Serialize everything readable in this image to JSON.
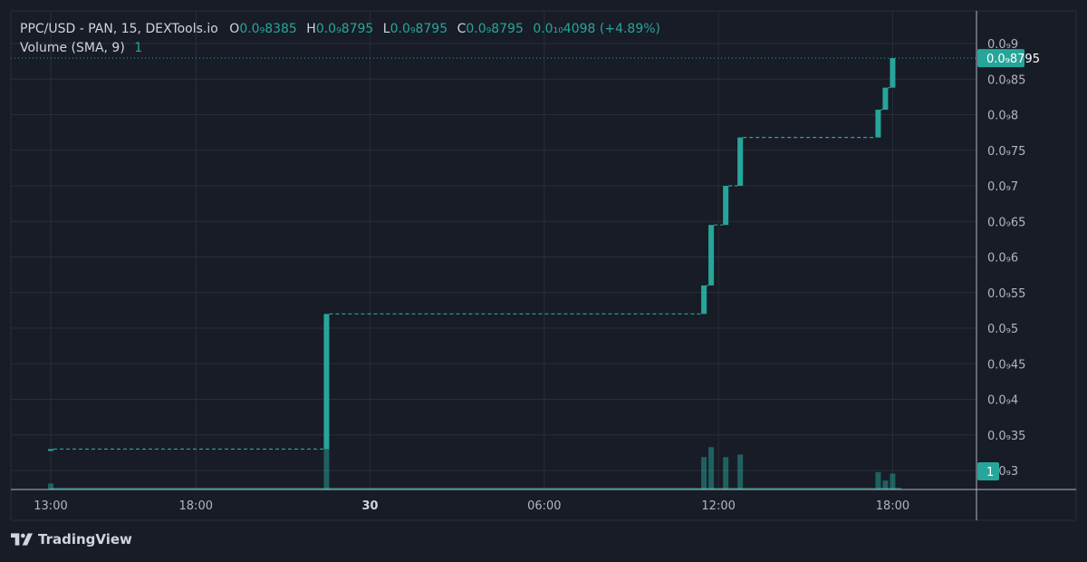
{
  "legend": {
    "symbol": "PPC/USD - PAN, 15, DEXTools.io",
    "open_key": "O",
    "open_val": "0.0₉8385",
    "high_key": "H",
    "high_val": "0.0₉8795",
    "low_key": "L",
    "low_val": "0.0₉8795",
    "close_key": "C",
    "close_val": "0.0₉8795",
    "change": "0.0₁₀4098 (+4.89%)",
    "volume_label": "Volume (SMA, 9)",
    "volume_value": "1"
  },
  "brand": {
    "name": "TradingView",
    "icon": "tradingview-logo-icon"
  },
  "colors": {
    "up": "#26a69a",
    "grid": "#2a2e39",
    "background": "#181c27",
    "volume": "#26a69a80"
  },
  "chart_data": {
    "type": "candlestick",
    "price_scale_labels": [
      "0.0₉9",
      "0.0₉85",
      "0.0₉8",
      "0.0₉75",
      "0.0₉7",
      "0.0₉65",
      "0.0₉6",
      "0.0₉55",
      "0.0₉5",
      "0.0₉45",
      "0.0₉4",
      "0.0₉35",
      "0.0₉3"
    ],
    "price_scale_values": [
      0.9,
      0.85,
      0.8,
      0.75,
      0.7,
      0.65,
      0.6,
      0.55,
      0.5,
      0.45,
      0.4,
      0.35,
      0.3
    ],
    "price_unit": "×1e-10",
    "ylim": [
      0.28,
      0.93
    ],
    "x_ticks": [
      {
        "label": "13:00",
        "hour": 0
      },
      {
        "label": "18:00",
        "hour": 5
      },
      {
        "label": "30",
        "hour": 11
      },
      {
        "label": "06:00",
        "hour": 17
      },
      {
        "label": "12:00",
        "hour": 23
      },
      {
        "label": "18:00",
        "hour": 29
      }
    ],
    "xlim_hours": [
      0,
      33.5
    ],
    "current_price_label": "0.0₉8795",
    "current_price_value": 0.8795,
    "volume_label": "1",
    "candles": [
      {
        "t": 0.0,
        "o": 0.33,
        "c": 0.33
      },
      {
        "t": 9.5,
        "o": 0.33,
        "c": 0.52
      },
      {
        "t": 22.5,
        "o": 0.52,
        "c": 0.56
      },
      {
        "t": 22.75,
        "o": 0.56,
        "c": 0.645
      },
      {
        "t": 23.25,
        "o": 0.645,
        "c": 0.7
      },
      {
        "t": 23.75,
        "o": 0.7,
        "c": 0.768
      },
      {
        "t": 28.5,
        "o": 0.768,
        "c": 0.807
      },
      {
        "t": 28.75,
        "o": 0.807,
        "c": 0.838
      },
      {
        "t": 29.0,
        "o": 0.838,
        "c": 0.8795
      }
    ],
    "volumes": [
      {
        "t": 0.0,
        "v": 0.12
      },
      {
        "t": 9.5,
        "v": 1.0
      },
      {
        "t": 22.5,
        "v": 0.65
      },
      {
        "t": 22.75,
        "v": 0.85
      },
      {
        "t": 23.25,
        "v": 0.65
      },
      {
        "t": 23.75,
        "v": 0.7
      },
      {
        "t": 28.5,
        "v": 0.35
      },
      {
        "t": 28.75,
        "v": 0.18
      },
      {
        "t": 29.0,
        "v": 0.32
      }
    ]
  }
}
